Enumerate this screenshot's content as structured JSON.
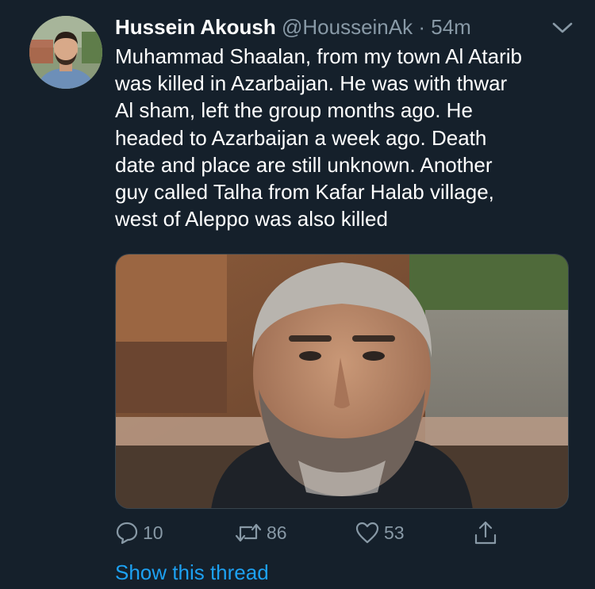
{
  "tweet": {
    "author": {
      "display_name": "Hussein Akoush",
      "handle": "@HousseinAk",
      "separator": "·",
      "timestamp": "54m"
    },
    "text": "Muhammad Shaalan, from my town Al Atarib\nwas killed in Azarbaijan. He was with thwar\nAl sham, left the group months ago. He\nheaded to Azarbaijan a week ago. Death\ndate and place are still unknown. Another\nguy called Talha from Kafar Halab village,\nwest of Aleppo was also killed",
    "actions": {
      "replies": "10",
      "retweets": "86",
      "likes": "53"
    },
    "show_thread_label": "Show this thread"
  },
  "icons": {
    "caret": "chevron-down-icon",
    "reply": "speech-bubble-icon",
    "retweet": "retweet-arrows-icon",
    "like": "heart-icon",
    "share": "share-upload-icon"
  },
  "colors": {
    "background": "#15202b",
    "text_primary": "#ffffff",
    "text_secondary": "#8899a6",
    "link": "#1da1f2"
  }
}
